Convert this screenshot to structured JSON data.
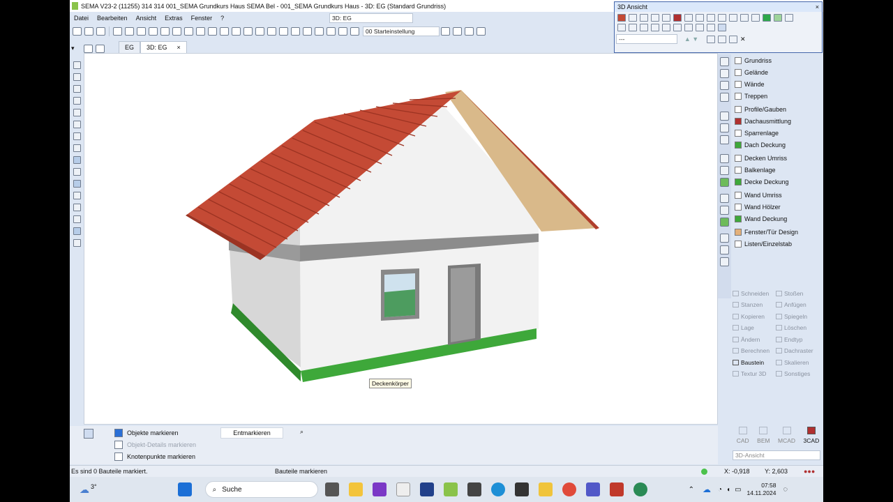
{
  "window": {
    "title": "SEMA  V23-2 (11255) 314 314 001_SEMA Grundkurs Haus SEMA Bel - 001_SEMA Grundkurs Haus  - 3D: EG (Standard Grundriss)"
  },
  "menu": [
    "Datei",
    "Bearbeiten",
    "Ansicht",
    "Extras",
    "Fenster",
    "?"
  ],
  "view_combo": "3D: EG",
  "start_setting": "00 Starteinstellung",
  "tabs": [
    "EG",
    "3D: EG"
  ],
  "tab_close": "×",
  "tooltip": "Deckenkörper",
  "panel": {
    "title": "3D Ansicht",
    "close": "×",
    "combo": "---"
  },
  "categories": [
    "Grundriss",
    "Gelände",
    "Wände",
    "Treppen",
    "Profile/Gauben",
    "Dachausmittlung",
    "Sparrenlage",
    "Dach Deckung",
    "Decken Umriss",
    "Balkenlage",
    "Decke Deckung",
    "Wand Umriss",
    "Wand Hölzer",
    "Wand Deckung",
    "Fenster/Tür Design",
    "Listen/Einzelstab"
  ],
  "ops": [
    [
      "Schneiden",
      "Stoßen"
    ],
    [
      "Stanzen",
      "Anfügen"
    ],
    [
      "Kopieren",
      "Spiegeln"
    ],
    [
      "Lage",
      "Löschen"
    ],
    [
      "Ändern",
      "Endtyp"
    ],
    [
      "Berechnen",
      "Dachraster"
    ],
    [
      "Baustein",
      "Skalieren"
    ],
    [
      "Textur 3D",
      "Sonstiges"
    ]
  ],
  "modes": [
    "CAD",
    "BEM",
    "MCAD",
    "3CAD"
  ],
  "mode_combo": "3D-Ansicht",
  "bottom": {
    "select_objects": "Objekte markieren",
    "deselect": "Entmarkieren",
    "object_details": "Objekt-Details markieren",
    "nodes": "Knotenpunkte markieren"
  },
  "status": {
    "left": "Es sind 0 Bauteile markiert.",
    "center": "Bauteile markieren",
    "x": "X: -0,918",
    "y": "Y: 2,603"
  },
  "taskbar": {
    "weather": "3°",
    "search": "Suche",
    "time": "07:58",
    "date": "14.11.2024"
  },
  "colors": {
    "roof": "#c44a35",
    "grass": "#3ea83a",
    "wall": "#f2f2f2",
    "gable_wood": "#d9b98a",
    "band": "#8c8c8c"
  }
}
